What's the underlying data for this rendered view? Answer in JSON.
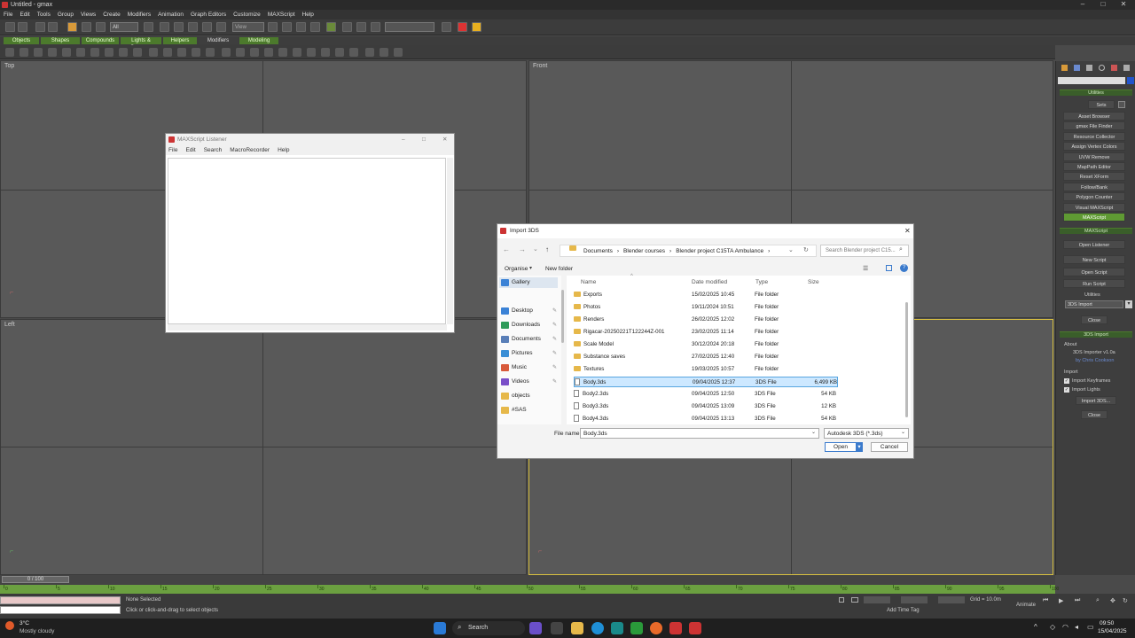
{
  "app": {
    "title": "Untitled - gmax",
    "menus": [
      "File",
      "Edit",
      "Tools",
      "Group",
      "Views",
      "Create",
      "Modifiers",
      "Animation",
      "Graph Editors",
      "Customize",
      "MAXScript",
      "Help"
    ],
    "toolbar_selection_filter": "All",
    "toolbar_view": "View"
  },
  "tabs": [
    "Objects",
    "Shapes",
    "Compounds",
    "Lights & Cameras",
    "Helpers",
    "Modifiers",
    "Modeling"
  ],
  "viewports": [
    {
      "label": "Top"
    },
    {
      "label": "Front"
    },
    {
      "label": "Left"
    },
    {
      "label": ""
    }
  ],
  "listener": {
    "title": "MAXScript Listener",
    "menus": [
      "File",
      "Edit",
      "Search",
      "MacroRecorder",
      "Help"
    ]
  },
  "dialog": {
    "title": "Import 3DS",
    "breadcrumb": [
      "Documents",
      "Blender courses",
      "Blender project C15TA Ambulance"
    ],
    "search_placeholder": "Search Blender project C15...",
    "organise": "Organise",
    "new_folder": "New folder",
    "nav": [
      {
        "label": "Gallery",
        "color": "#3b82d6"
      },
      {
        "label": "Desktop",
        "color": "#3b82d6"
      },
      {
        "label": "Downloads",
        "color": "#2f9b5a"
      },
      {
        "label": "Documents",
        "color": "#5a7fb8"
      },
      {
        "label": "Pictures",
        "color": "#3b8fd6"
      },
      {
        "label": "Music",
        "color": "#d85a3b"
      },
      {
        "label": "Videos",
        "color": "#7a4fc8"
      },
      {
        "label": "objects",
        "color": "#e6b84a"
      },
      {
        "label": "#SAS",
        "color": "#e6b84a"
      }
    ],
    "columns": [
      "Name",
      "Date modified",
      "Type",
      "Size"
    ],
    "files": [
      {
        "name": "Exports",
        "date": "15/02/2025 10:45",
        "type": "File folder",
        "size": "",
        "folder": true
      },
      {
        "name": "Photos",
        "date": "19/11/2024 10:51",
        "type": "File folder",
        "size": "",
        "folder": true
      },
      {
        "name": "Renders",
        "date": "26/02/2025 12:02",
        "type": "File folder",
        "size": "",
        "folder": true
      },
      {
        "name": "Rigacar-20250221T122244Z-001",
        "date": "23/02/2025 11:14",
        "type": "File folder",
        "size": "",
        "folder": true
      },
      {
        "name": "Scale Model",
        "date": "30/12/2024 20:18",
        "type": "File folder",
        "size": "",
        "folder": true
      },
      {
        "name": "Substance saves",
        "date": "27/02/2025 12:40",
        "type": "File folder",
        "size": "",
        "folder": true
      },
      {
        "name": "Textures",
        "date": "19/03/2025 10:57",
        "type": "File folder",
        "size": "",
        "folder": true
      },
      {
        "name": "Body.3ds",
        "date": "09/04/2025 12:37",
        "type": "3DS File",
        "size": "6,499 KB",
        "folder": false,
        "selected": true
      },
      {
        "name": "Body2.3ds",
        "date": "09/04/2025 12:50",
        "type": "3DS File",
        "size": "54 KB",
        "folder": false
      },
      {
        "name": "Body3.3ds",
        "date": "09/04/2025 13:09",
        "type": "3DS File",
        "size": "12 KB",
        "folder": false
      },
      {
        "name": "Body4.3ds",
        "date": "09/04/2025 13:13",
        "type": "3DS File",
        "size": "54 KB",
        "folder": false
      }
    ],
    "filename_label": "File name:",
    "filename_value": "Body.3ds",
    "filetype": "Autodesk 3DS (*.3ds)",
    "open_label": "Open",
    "cancel_label": "Cancel"
  },
  "command_panel": {
    "utilities_header": "Utilities",
    "sets_label": "Sets",
    "utilities": [
      "Asset Browser",
      "gmax File Finder",
      "Resource Collector",
      "Assign Vertex Colors",
      "UVW Remove",
      "MapPath Editor",
      "Reset XForm",
      "Follow/Bank",
      "Polygon Counter",
      "Visual MAXScript",
      "MAXScript"
    ],
    "maxscript_header": "MAXScript",
    "open_listener": "Open Listener",
    "new_script": "New Script",
    "open_script": "Open Script",
    "run_script": "Run Script",
    "utilities_label": "Utilities",
    "utilities_select": "3DS Import",
    "close_label": "Close",
    "import_header": "3DS Import",
    "about_label": "About",
    "about_text1": "3DS Importer v1.0a",
    "about_text2": "by Chris Cookson",
    "import_label": "Import",
    "import_keyframes": "Import Keyframes",
    "import_lights": "Import Lights",
    "import_button": "Import 3DS...",
    "close2_label": "Close"
  },
  "timeline": {
    "frame_display": "0 / 100",
    "ticks": [
      "0",
      "5",
      "10",
      "15",
      "20",
      "25",
      "30",
      "35",
      "40",
      "45",
      "50",
      "55",
      "60",
      "65",
      "70",
      "75",
      "80",
      "85",
      "90",
      "95",
      "100"
    ]
  },
  "status": {
    "none_selected": "None Selected",
    "hint": "Click or click-and-drag to select objects",
    "add_time_tag": "Add Time Tag",
    "grid": "Grid = 10.0m"
  },
  "taskbar": {
    "weather_temp": "3°C",
    "weather_desc": "Mostly cloudy",
    "search": "Search",
    "time": "09:50",
    "date": "15/04/2025"
  }
}
